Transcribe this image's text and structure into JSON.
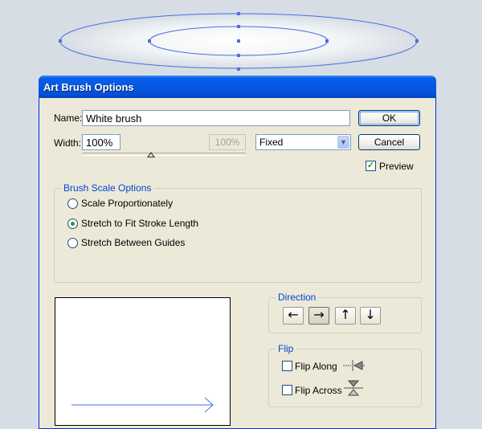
{
  "dialog": {
    "title": "Art Brush Options"
  },
  "name_field": {
    "label": "Name:",
    "value": "White brush"
  },
  "width_field": {
    "label": "Width:",
    "value": "100%",
    "secondary_value": "100%",
    "mode": "Fixed"
  },
  "buttons": {
    "ok": "OK",
    "cancel": "Cancel"
  },
  "preview": {
    "label": "Preview",
    "checked": true
  },
  "brush_scale": {
    "title": "Brush Scale Options",
    "options": [
      "Scale Proportionately",
      "Stretch to Fit Stroke Length",
      "Stretch Between Guides"
    ],
    "selected_index": 1
  },
  "direction": {
    "title": "Direction",
    "buttons": [
      "←",
      "→",
      "↑",
      "↓"
    ],
    "selected_index": 1
  },
  "flip": {
    "title": "Flip",
    "along_label": "Flip Along",
    "across_label": "Flip Across"
  },
  "colors": {
    "title_bar": "#0558e3",
    "dialog_bg": "#ece9d8",
    "accent_text": "#0046d5",
    "ellipse_stroke": "#4a6fe3"
  }
}
